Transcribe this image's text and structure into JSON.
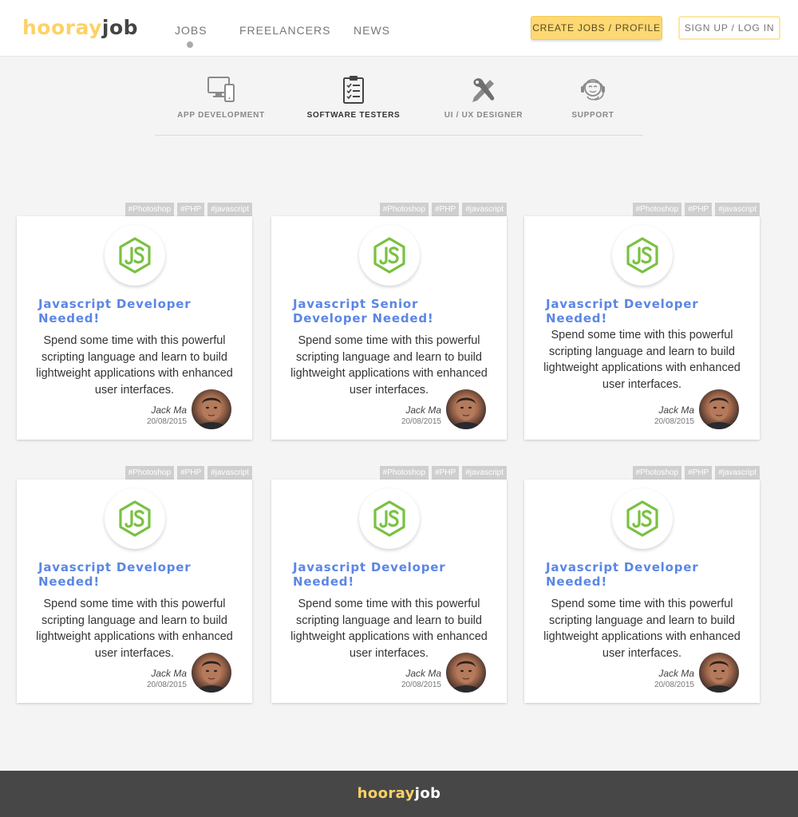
{
  "header": {
    "logo_part1": "hooray",
    "logo_part2": "job",
    "nav": [
      "JOBS",
      "FREELANCERS",
      "NEWS"
    ],
    "active_nav": "JOBS",
    "create_button": "CREATE JOBS / PROFILE",
    "signup_button": "SIGN UP / LOG IN"
  },
  "categories": [
    {
      "label": "APP DEVELOPMENT",
      "icon": "devices-icon"
    },
    {
      "label": "SOFTWARE TESTERS",
      "icon": "clipboard-checklist-icon",
      "active": true
    },
    {
      "label": "UI / UX DESIGNER",
      "icon": "pencil-brush-icon"
    },
    {
      "label": "SUPPORT",
      "icon": "headset-icon"
    }
  ],
  "cards": [
    {
      "title": "Javascript Developer Needed!",
      "description": "Spend some time with this powerful scripting language and learn to build lightweight applications with enhanced user interfaces.",
      "author": "Jack Ma",
      "date": "20/08/2015",
      "tags": [
        "#Photoshop",
        "#PHP",
        "#javascript"
      ]
    },
    {
      "title": "Javascript Senior Developer Needed!",
      "description": "Spend some time with this powerful scripting language and learn to build lightweight applications with enhanced user interfaces.",
      "author": "Jack Ma",
      "date": "20/08/2015",
      "tags": [
        "#Photoshop",
        "#PHP",
        "#javascript"
      ]
    },
    {
      "title": "Javascript Developer Needed!",
      "description": "Spend some time with this powerful scripting language and learn to build lightweight applications with enhanced user interfaces.",
      "author": "Jack Ma",
      "date": "20/08/2015",
      "tags": [
        "#Photoshop",
        "#PHP",
        "#javascript"
      ]
    },
    {
      "title": "Javascript Developer Needed!",
      "description": "Spend some time with this powerful scripting language and learn to build lightweight applications with enhanced user interfaces.",
      "author": "Jack Ma",
      "date": "20/08/2015",
      "tags": [
        "#Photoshop",
        "#PHP",
        "#javascript"
      ]
    },
    {
      "title": "Javascript Developer Needed!",
      "description": "Spend some time with this powerful scripting language and learn to build lightweight applications with enhanced user interfaces.",
      "author": "Jack Ma",
      "date": "20/08/2015",
      "tags": [
        "#Photoshop",
        "#PHP",
        "#javascript"
      ]
    },
    {
      "title": "Javascript Developer Needed!",
      "description": "Spend some time with this powerful scripting language and learn to build lightweight applications with enhanced user interfaces.",
      "author": "Jack Ma",
      "date": "20/08/2015",
      "tags": [
        "#Photoshop",
        "#PHP",
        "#javascript"
      ]
    }
  ],
  "footer": {
    "logo_part1": "hooray",
    "logo_part2": "job"
  },
  "colors": {
    "accent_yellow": "#fdd265",
    "title_blue": "#5b86e5",
    "js_green": "#7ac142",
    "footer_bg": "#474747"
  }
}
